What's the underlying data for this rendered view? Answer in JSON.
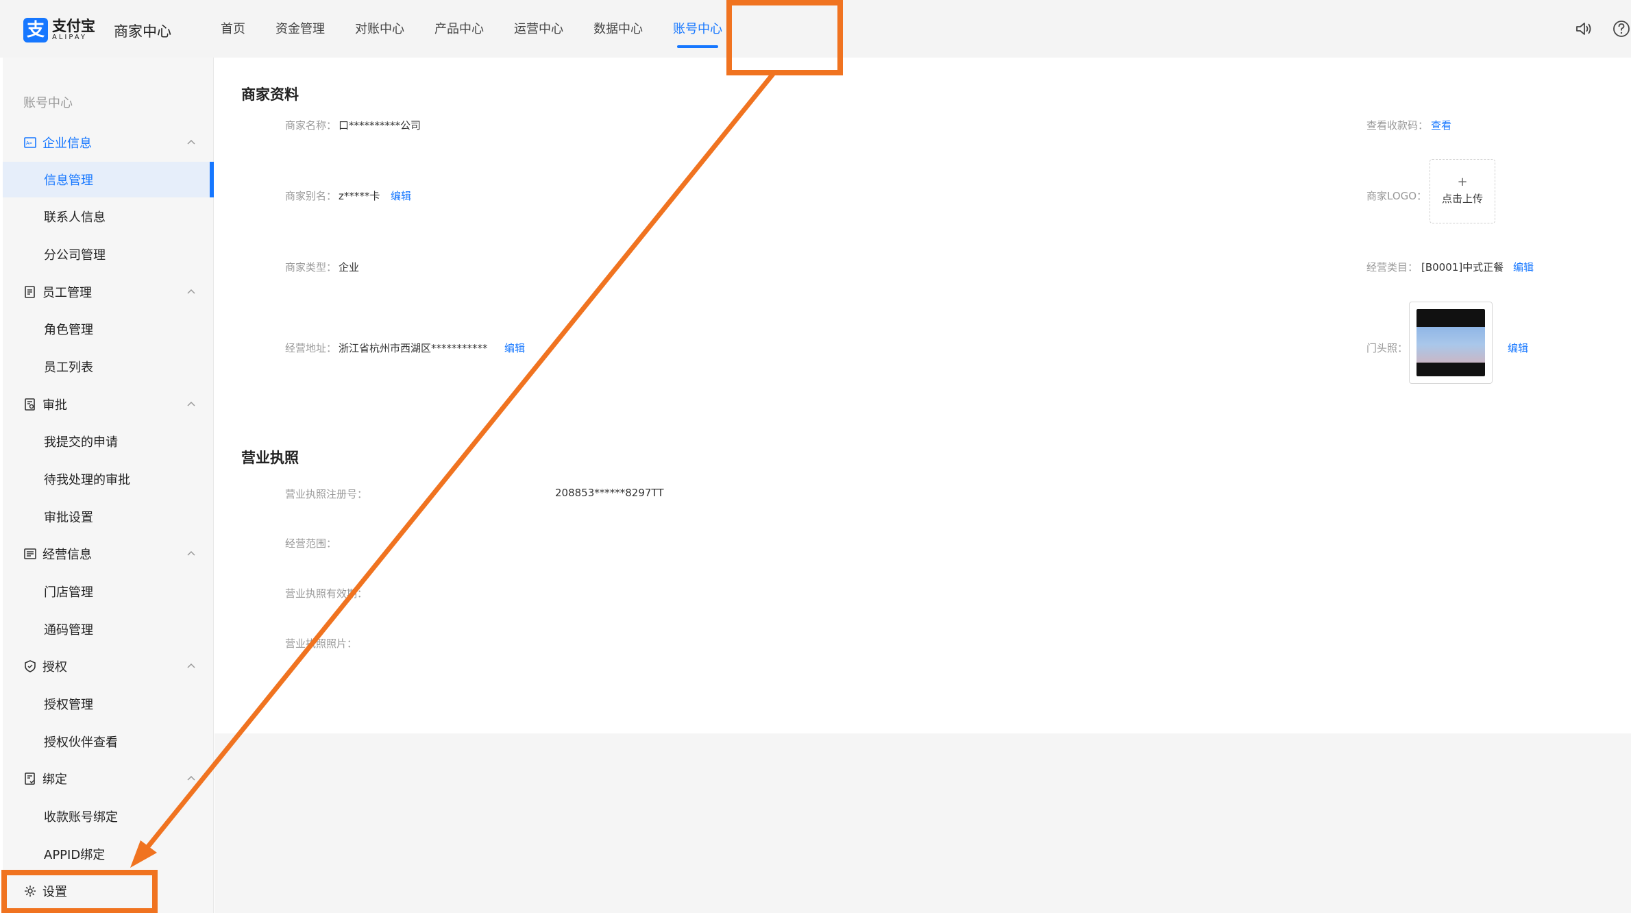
{
  "header": {
    "brand_cn": "支付宝",
    "brand_en": "ALIPAY",
    "app_title": "商家中心",
    "nav": [
      {
        "label": "首页"
      },
      {
        "label": "资金管理"
      },
      {
        "label": "对账中心"
      },
      {
        "label": "产品中心"
      },
      {
        "label": "运营中心"
      },
      {
        "label": "数据中心"
      },
      {
        "label": "账号中心",
        "active": true
      }
    ],
    "icons": [
      "speaker-icon",
      "help-icon"
    ]
  },
  "sidebar": {
    "heading": "账号中心",
    "items": [
      {
        "label": "企业信息",
        "type": "group",
        "icon": "id-card-icon"
      },
      {
        "label": "信息管理",
        "type": "sub",
        "selected": true
      },
      {
        "label": "联系人信息",
        "type": "sub"
      },
      {
        "label": "分公司管理",
        "type": "sub"
      },
      {
        "label": "员工管理",
        "type": "group",
        "icon": "staff-icon"
      },
      {
        "label": "角色管理",
        "type": "sub"
      },
      {
        "label": "员工列表",
        "type": "sub"
      },
      {
        "label": "审批",
        "type": "group",
        "icon": "approval-icon"
      },
      {
        "label": "我提交的申请",
        "type": "sub"
      },
      {
        "label": "待我处理的审批",
        "type": "sub"
      },
      {
        "label": "审批设置",
        "type": "sub"
      },
      {
        "label": "经营信息",
        "type": "group",
        "icon": "business-icon"
      },
      {
        "label": "门店管理",
        "type": "sub"
      },
      {
        "label": "通码管理",
        "type": "sub"
      },
      {
        "label": "授权",
        "type": "group",
        "icon": "shield-icon"
      },
      {
        "label": "授权管理",
        "type": "sub"
      },
      {
        "label": "授权伙伴查看",
        "type": "sub"
      },
      {
        "label": "绑定",
        "type": "group",
        "icon": "bind-icon"
      },
      {
        "label": "收款账号绑定",
        "type": "sub"
      },
      {
        "label": "APPID绑定",
        "type": "sub"
      },
      {
        "label": "设置",
        "type": "group",
        "icon": "gear-icon"
      }
    ]
  },
  "merchant_profile": {
    "title": "商家资料",
    "name_label": "商家名称：",
    "name_value": "口**********公司",
    "qr_label": "查看收款码：",
    "qr_link": "查看",
    "alias_label": "商家别名：",
    "alias_value": "z*****卡",
    "alias_edit": "编辑",
    "logo_label": "商家LOGO：",
    "logo_upload_plus": "+",
    "logo_upload": "点击上传",
    "type_label": "商家类型：",
    "type_value": "企业",
    "category_label": "经营类目：",
    "category_value": "[B0001]中式正餐",
    "category_edit": "编辑",
    "address_label": "经营地址：",
    "address_value": "浙江省杭州市西湖区***********",
    "address_edit": "编辑",
    "storefront_label": "门头照：",
    "storefront_edit": "编辑"
  },
  "business_license": {
    "title": "营业执照",
    "reg_no_label": "营业执照注册号：",
    "reg_no_value": "208853******8297TT",
    "scope_label": "经营范围：",
    "validity_label": "营业执照有效期：",
    "photo_label": "营业执照照片："
  },
  "annotation": {
    "color": "#f07320"
  }
}
